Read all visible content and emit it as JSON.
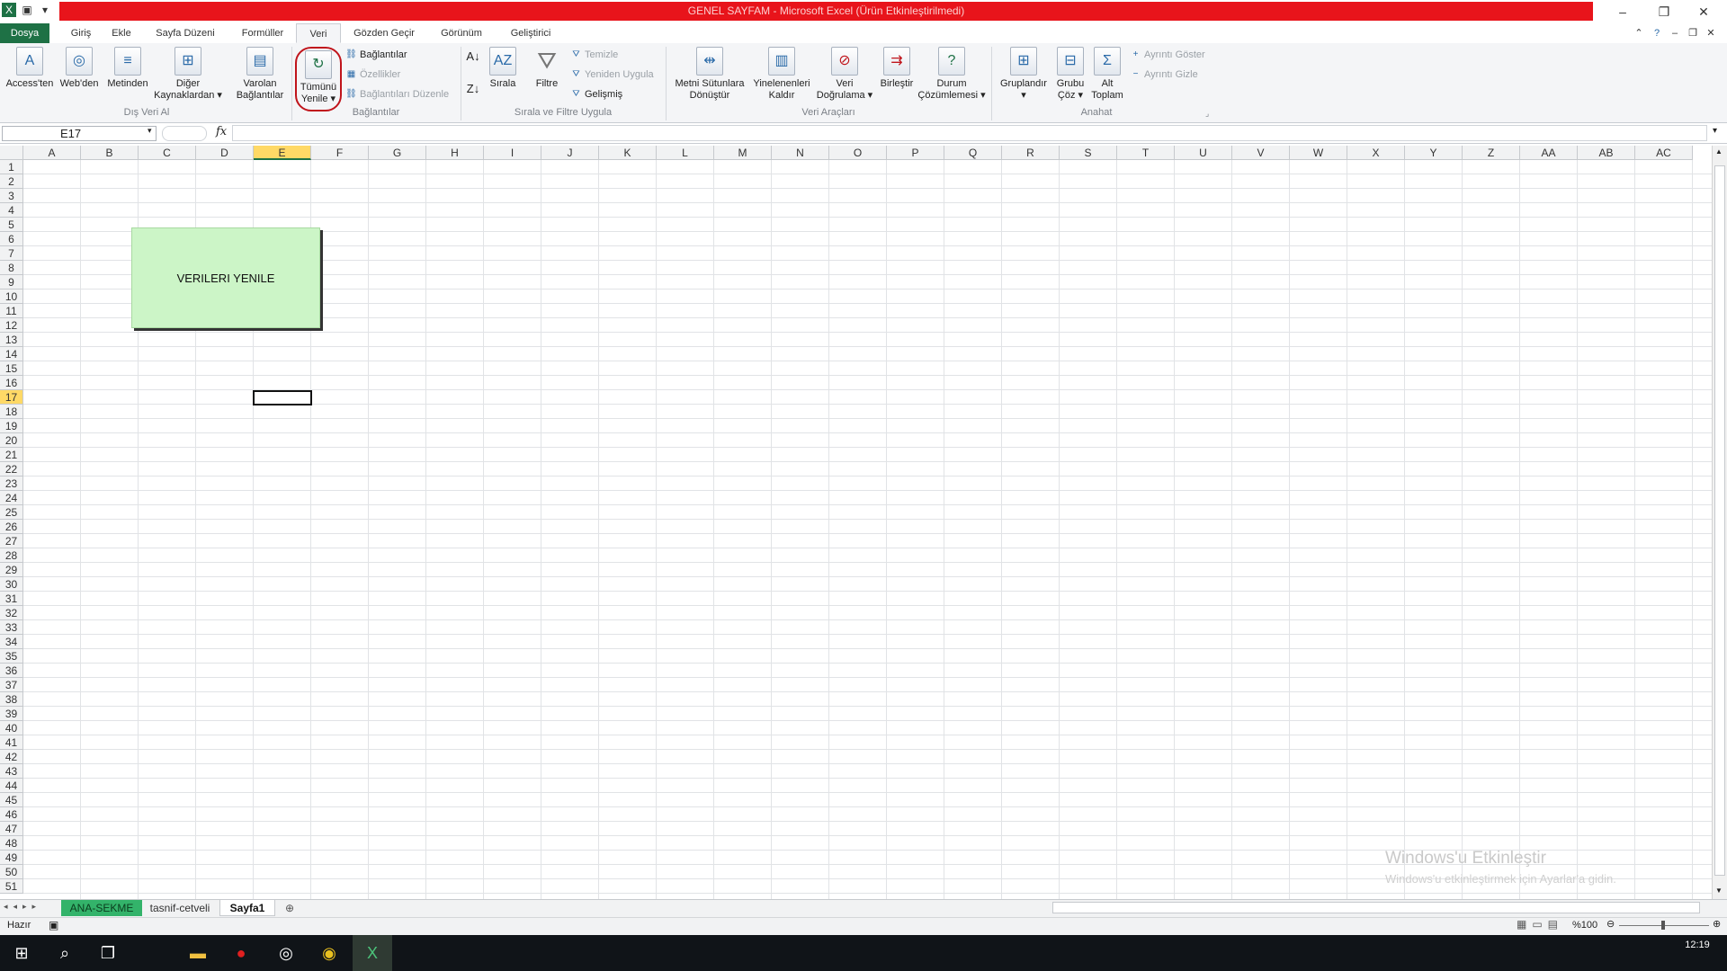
{
  "app": {
    "title": "GENEL SAYFAM - Microsoft Excel (Ürün Etkinleştirilmedi)"
  },
  "tabs": [
    "Dosya",
    "Giriş",
    "Ekle",
    "Sayfa Düzeni",
    "Formüller",
    "Veri",
    "Gözden Geçir",
    "Görünüm",
    "Geliştirici"
  ],
  "active_tab": "Veri",
  "ribbon": {
    "dis_veri_al": {
      "group_label": "Dış Veri Al",
      "access": "Access'ten",
      "web": "Web'den",
      "metin": "Metinden",
      "diger_l1": "Diğer",
      "diger_l2": "Kaynaklardan ▾"
    },
    "baglantilar": {
      "group_label": "Bağlantılar",
      "varolan_l1": "Varolan",
      "varolan_l2": "Bağlantılar",
      "tumunu_l1": "Tümünü",
      "tumunu_l2": "Yenile ▾",
      "baglantilar": "Bağlantılar",
      "ozellikler": "Özellikler",
      "duzenle": "Bağlantıları Düzenle"
    },
    "sirala_filtre": {
      "group_label": "Sırala ve Filtre Uygula",
      "sirala": "Sırala",
      "filtre": "Filtre",
      "temizle": "Temizle",
      "yeniden": "Yeniden Uygula",
      "gelismis": "Gelişmiş"
    },
    "veri_araclari": {
      "group_label": "Veri Araçları",
      "metni_l1": "Metni Sütunlara",
      "metni_l2": "Dönüştür",
      "yinelenen_l1": "Yinelenenleri",
      "yinelenen_l2": "Kaldır",
      "dogrulama_l1": "Veri",
      "dogrulama_l2": "Doğrulama ▾",
      "birlestir": "Birleştir",
      "durum_l1": "Durum",
      "durum_l2": "Çözümlemesi ▾"
    },
    "anahat": {
      "group_label": "Anahat",
      "grupla": "Gruplandır",
      "grupla_arrow": "▾",
      "coz_l1": "Grubu",
      "coz_l2": "Çöz ▾",
      "alt_l1": "Alt",
      "alt_l2": "Toplam",
      "goster": "Ayrıntı Göster",
      "gizle": "Ayrıntı Gizle"
    }
  },
  "formula_bar": {
    "name_box": "E17",
    "fx": "fx",
    "value": ""
  },
  "columns": [
    "A",
    "B",
    "C",
    "D",
    "E",
    "F",
    "G",
    "H",
    "I",
    "J",
    "K",
    "L",
    "M",
    "N",
    "O",
    "P",
    "Q",
    "R",
    "S",
    "T",
    "U",
    "V",
    "W",
    "X",
    "Y",
    "Z",
    "AA",
    "AB",
    "AC"
  ],
  "rows": [
    "1",
    "2",
    "3",
    "4",
    "5",
    "6",
    "7",
    "8",
    "9",
    "10",
    "11",
    "12",
    "13",
    "14",
    "15",
    "16",
    "17",
    "18",
    "19",
    "20",
    "21",
    "22",
    "23",
    "24",
    "25",
    "26",
    "27",
    "28",
    "29",
    "30",
    "31",
    "32",
    "33",
    "34",
    "35",
    "36",
    "37",
    "38",
    "39",
    "40",
    "41",
    "42",
    "43",
    "44",
    "45",
    "46",
    "47",
    "48",
    "49",
    "50",
    "51"
  ],
  "active_cell": {
    "col": "E",
    "row": "17"
  },
  "shape_button": {
    "label": "VERILERI YENILE",
    "fill": "#ccf5c7"
  },
  "sheets": [
    "ANA-SEKME",
    "tasnif-cetveli",
    "Sayfa1"
  ],
  "active_sheet": "Sayfa1",
  "status": {
    "mode": "Hazır",
    "zoom": "%100"
  },
  "watermark": {
    "line1": "Windows'u Etkinleştir",
    "line2": "Windows'u etkinleştirmek için Ayarlar'a gidin."
  },
  "taskbar": {
    "clock": "12:19"
  },
  "colors": {
    "excel_green": "#1e7145",
    "title_red": "#e8141b",
    "active_sheet_tab": "#33b36a"
  }
}
